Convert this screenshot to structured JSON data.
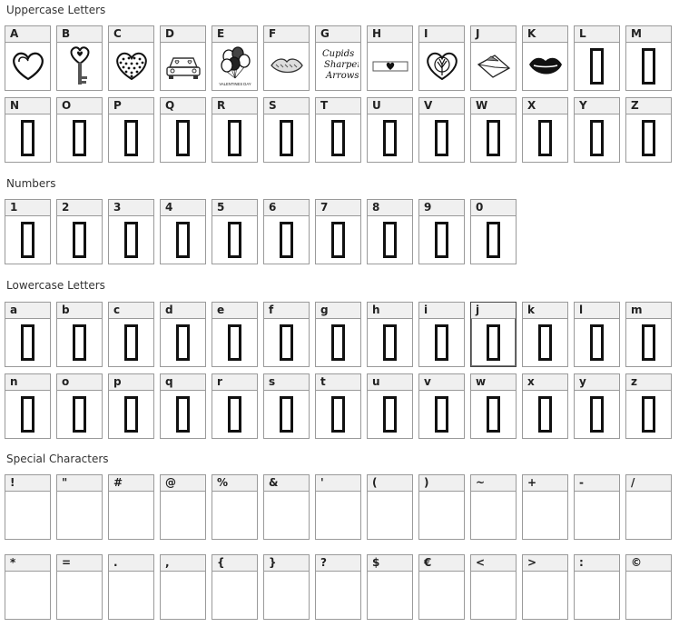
{
  "sections": {
    "uppercase": "Uppercase Letters",
    "numbers": "Numbers",
    "lowercase": "Lowercase Letters",
    "special": "Special Characters"
  },
  "uppercase": [
    {
      "char": "A",
      "glyph": "outline-heart-icon"
    },
    {
      "char": "B",
      "glyph": "heart-key-icon"
    },
    {
      "char": "C",
      "glyph": "polka-dot-heart-icon"
    },
    {
      "char": "D",
      "glyph": "car-icon"
    },
    {
      "char": "E",
      "glyph": "balloons-icon",
      "glyph_text": "VALENTINES DAY"
    },
    {
      "char": "F",
      "glyph": "lips-sketch-icon"
    },
    {
      "char": "G",
      "glyph": "script-text-icon",
      "glyph_text": [
        "Cupids",
        "Sharpening",
        "Arrows"
      ]
    },
    {
      "char": "H",
      "glyph": "ribbon-heart-icon"
    },
    {
      "char": "I",
      "glyph": "tree-heart-icon"
    },
    {
      "char": "J",
      "glyph": "envelope-icon"
    },
    {
      "char": "K",
      "glyph": "kiss-lips-icon"
    },
    {
      "char": "L",
      "glyph": "missing-glyph-icon"
    },
    {
      "char": "M",
      "glyph": "missing-glyph-icon"
    },
    {
      "char": "N",
      "glyph": "missing-glyph-icon"
    },
    {
      "char": "O",
      "glyph": "missing-glyph-icon"
    },
    {
      "char": "P",
      "glyph": "missing-glyph-icon"
    },
    {
      "char": "Q",
      "glyph": "missing-glyph-icon"
    },
    {
      "char": "R",
      "glyph": "missing-glyph-icon"
    },
    {
      "char": "S",
      "glyph": "missing-glyph-icon"
    },
    {
      "char": "T",
      "glyph": "missing-glyph-icon"
    },
    {
      "char": "U",
      "glyph": "missing-glyph-icon"
    },
    {
      "char": "V",
      "glyph": "missing-glyph-icon"
    },
    {
      "char": "W",
      "glyph": "missing-glyph-icon"
    },
    {
      "char": "X",
      "glyph": "missing-glyph-icon"
    },
    {
      "char": "Y",
      "glyph": "missing-glyph-icon"
    },
    {
      "char": "Z",
      "glyph": "missing-glyph-icon"
    }
  ],
  "numbers": [
    "1",
    "2",
    "3",
    "4",
    "5",
    "6",
    "7",
    "8",
    "9",
    "0"
  ],
  "lowercase": [
    "a",
    "b",
    "c",
    "d",
    "e",
    "f",
    "g",
    "h",
    "i",
    "j",
    "k",
    "l",
    "m",
    "n",
    "o",
    "p",
    "q",
    "r",
    "s",
    "t",
    "u",
    "v",
    "w",
    "x",
    "y",
    "z"
  ],
  "lowercase_selected": "j",
  "special": [
    "!",
    "\"",
    "#",
    "@",
    "%",
    "&",
    "'",
    "(",
    ")",
    "~",
    "+",
    "-",
    "/",
    "*",
    "=",
    ".",
    ",",
    "{",
    "}",
    "?",
    "$",
    "€",
    "<",
    ">",
    ":",
    "©"
  ],
  "colors": {
    "label_bg": "#f0f0f0",
    "border": "#9a9a9a",
    "glyph": "#111111"
  }
}
